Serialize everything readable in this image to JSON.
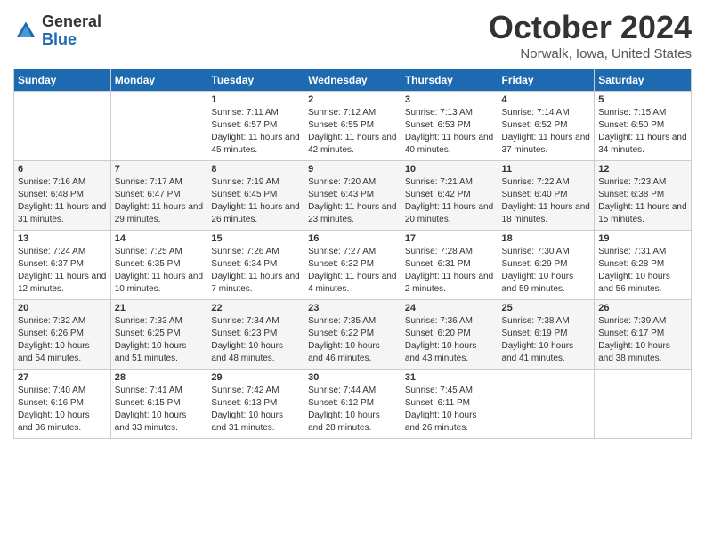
{
  "logo": {
    "general": "General",
    "blue": "Blue"
  },
  "title": "October 2024",
  "location": "Norwalk, Iowa, United States",
  "days_of_week": [
    "Sunday",
    "Monday",
    "Tuesday",
    "Wednesday",
    "Thursday",
    "Friday",
    "Saturday"
  ],
  "weeks": [
    [
      {
        "day": "",
        "detail": ""
      },
      {
        "day": "",
        "detail": ""
      },
      {
        "day": "1",
        "detail": "Sunrise: 7:11 AM\nSunset: 6:57 PM\nDaylight: 11 hours and 45 minutes."
      },
      {
        "day": "2",
        "detail": "Sunrise: 7:12 AM\nSunset: 6:55 PM\nDaylight: 11 hours and 42 minutes."
      },
      {
        "day": "3",
        "detail": "Sunrise: 7:13 AM\nSunset: 6:53 PM\nDaylight: 11 hours and 40 minutes."
      },
      {
        "day": "4",
        "detail": "Sunrise: 7:14 AM\nSunset: 6:52 PM\nDaylight: 11 hours and 37 minutes."
      },
      {
        "day": "5",
        "detail": "Sunrise: 7:15 AM\nSunset: 6:50 PM\nDaylight: 11 hours and 34 minutes."
      }
    ],
    [
      {
        "day": "6",
        "detail": "Sunrise: 7:16 AM\nSunset: 6:48 PM\nDaylight: 11 hours and 31 minutes."
      },
      {
        "day": "7",
        "detail": "Sunrise: 7:17 AM\nSunset: 6:47 PM\nDaylight: 11 hours and 29 minutes."
      },
      {
        "day": "8",
        "detail": "Sunrise: 7:19 AM\nSunset: 6:45 PM\nDaylight: 11 hours and 26 minutes."
      },
      {
        "day": "9",
        "detail": "Sunrise: 7:20 AM\nSunset: 6:43 PM\nDaylight: 11 hours and 23 minutes."
      },
      {
        "day": "10",
        "detail": "Sunrise: 7:21 AM\nSunset: 6:42 PM\nDaylight: 11 hours and 20 minutes."
      },
      {
        "day": "11",
        "detail": "Sunrise: 7:22 AM\nSunset: 6:40 PM\nDaylight: 11 hours and 18 minutes."
      },
      {
        "day": "12",
        "detail": "Sunrise: 7:23 AM\nSunset: 6:38 PM\nDaylight: 11 hours and 15 minutes."
      }
    ],
    [
      {
        "day": "13",
        "detail": "Sunrise: 7:24 AM\nSunset: 6:37 PM\nDaylight: 11 hours and 12 minutes."
      },
      {
        "day": "14",
        "detail": "Sunrise: 7:25 AM\nSunset: 6:35 PM\nDaylight: 11 hours and 10 minutes."
      },
      {
        "day": "15",
        "detail": "Sunrise: 7:26 AM\nSunset: 6:34 PM\nDaylight: 11 hours and 7 minutes."
      },
      {
        "day": "16",
        "detail": "Sunrise: 7:27 AM\nSunset: 6:32 PM\nDaylight: 11 hours and 4 minutes."
      },
      {
        "day": "17",
        "detail": "Sunrise: 7:28 AM\nSunset: 6:31 PM\nDaylight: 11 hours and 2 minutes."
      },
      {
        "day": "18",
        "detail": "Sunrise: 7:30 AM\nSunset: 6:29 PM\nDaylight: 10 hours and 59 minutes."
      },
      {
        "day": "19",
        "detail": "Sunrise: 7:31 AM\nSunset: 6:28 PM\nDaylight: 10 hours and 56 minutes."
      }
    ],
    [
      {
        "day": "20",
        "detail": "Sunrise: 7:32 AM\nSunset: 6:26 PM\nDaylight: 10 hours and 54 minutes."
      },
      {
        "day": "21",
        "detail": "Sunrise: 7:33 AM\nSunset: 6:25 PM\nDaylight: 10 hours and 51 minutes."
      },
      {
        "day": "22",
        "detail": "Sunrise: 7:34 AM\nSunset: 6:23 PM\nDaylight: 10 hours and 48 minutes."
      },
      {
        "day": "23",
        "detail": "Sunrise: 7:35 AM\nSunset: 6:22 PM\nDaylight: 10 hours and 46 minutes."
      },
      {
        "day": "24",
        "detail": "Sunrise: 7:36 AM\nSunset: 6:20 PM\nDaylight: 10 hours and 43 minutes."
      },
      {
        "day": "25",
        "detail": "Sunrise: 7:38 AM\nSunset: 6:19 PM\nDaylight: 10 hours and 41 minutes."
      },
      {
        "day": "26",
        "detail": "Sunrise: 7:39 AM\nSunset: 6:17 PM\nDaylight: 10 hours and 38 minutes."
      }
    ],
    [
      {
        "day": "27",
        "detail": "Sunrise: 7:40 AM\nSunset: 6:16 PM\nDaylight: 10 hours and 36 minutes."
      },
      {
        "day": "28",
        "detail": "Sunrise: 7:41 AM\nSunset: 6:15 PM\nDaylight: 10 hours and 33 minutes."
      },
      {
        "day": "29",
        "detail": "Sunrise: 7:42 AM\nSunset: 6:13 PM\nDaylight: 10 hours and 31 minutes."
      },
      {
        "day": "30",
        "detail": "Sunrise: 7:44 AM\nSunset: 6:12 PM\nDaylight: 10 hours and 28 minutes."
      },
      {
        "day": "31",
        "detail": "Sunrise: 7:45 AM\nSunset: 6:11 PM\nDaylight: 10 hours and 26 minutes."
      },
      {
        "day": "",
        "detail": ""
      },
      {
        "day": "",
        "detail": ""
      }
    ]
  ]
}
